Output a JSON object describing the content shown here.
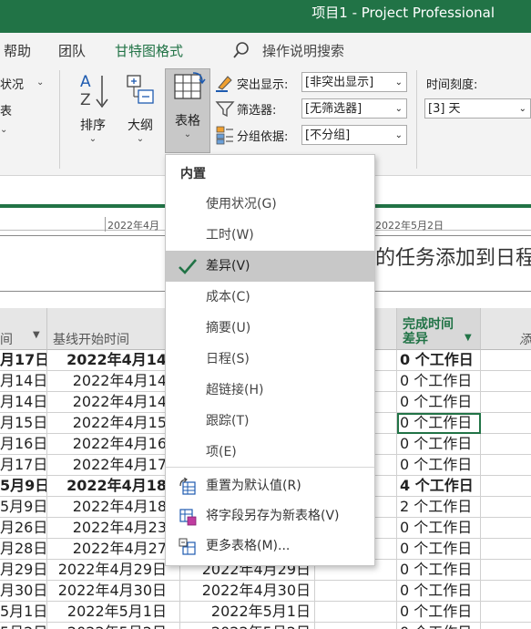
{
  "window": {
    "title": "项目1  -  Project Professional"
  },
  "tabs": [
    {
      "label": "帮助"
    },
    {
      "label": "团队"
    },
    {
      "label": "甘特图格式",
      "active": true
    },
    {
      "label": "操作说明搜索"
    }
  ],
  "ribbon": {
    "left_cut_1": "状况",
    "left_cut_2": "表",
    "sort": {
      "label": "排序"
    },
    "outline": {
      "label": "大纲"
    },
    "tables": {
      "label": "表格"
    },
    "highlight": {
      "label": "突出显示:",
      "value": "[非突出显示]"
    },
    "filter": {
      "label": "筛选器:",
      "value": "[无筛选器]"
    },
    "group": {
      "label": "分组依据:",
      "value": "[不分组]"
    },
    "timescale": {
      "label": "时间刻度:",
      "value": "[3] 天"
    }
  },
  "timeline": {
    "date_left": "2022年4月",
    "date_right": "2022年5月2日",
    "message": "的任务添加到日程表"
  },
  "grid": {
    "headers": {
      "col1": "间",
      "col2": "基线开始时间",
      "col4a": "完成时间",
      "col4b": "差异",
      "col5": "添"
    },
    "rows": [
      {
        "c1": "月17日",
        "c2": "2022年4月14",
        "c3": "年",
        "c4": "0 个工作日",
        "bold": true
      },
      {
        "c1": "月14日",
        "c2": "2022年4月14",
        "c3": "年",
        "c4": "0 个工作日"
      },
      {
        "c1": "月14日",
        "c2": "2022年4月14",
        "c3": "年",
        "c4": "0 个工作日"
      },
      {
        "c1": "月15日",
        "c2": "2022年4月15",
        "c3": "年",
        "c4": "0 个工作日",
        "focus": true
      },
      {
        "c1": "月16日",
        "c2": "2022年4月16",
        "c3": "年",
        "c4": "0 个工作日"
      },
      {
        "c1": "月17日",
        "c2": "2022年4月17",
        "c3": "年",
        "c4": "0 个工作日"
      },
      {
        "c1": "5月9日",
        "c2": "2022年4月18",
        "c3": "年",
        "c4": "4 个工作日",
        "bold": true
      },
      {
        "c1": "5月9日",
        "c2": "2022年4月18",
        "c3": "年",
        "c4": "2 个工作日"
      },
      {
        "c1": "月26日",
        "c2": "2022年4月23",
        "c3": "年",
        "c4": "0 个工作日"
      },
      {
        "c1": "月28日",
        "c2": "2022年4月27",
        "c3": "年",
        "c4": "0 个工作日"
      },
      {
        "c1": "月29日",
        "c2": "2022年4月29日",
        "c3": "2022年4月29日",
        "c4": "0 个工作日"
      },
      {
        "c1": "月30日",
        "c2": "2022年4月30日",
        "c3": "2022年4月30日",
        "c4": "0 个工作日"
      },
      {
        "c1": "5月1日",
        "c2": "2022年5月1日",
        "c3": "2022年5月1日",
        "c4": "0 个工作日"
      },
      {
        "c1": "5月2日",
        "c2": "2022年5月2日",
        "c3": "2022年5月2日",
        "c4": "0 个工作日"
      }
    ]
  },
  "menu": {
    "heading": "内置",
    "items": [
      {
        "label": "使用状况(G)"
      },
      {
        "label": "工时(W)"
      },
      {
        "label": "差异(V)",
        "selected": true
      },
      {
        "label": "成本(C)"
      },
      {
        "label": "摘要(U)"
      },
      {
        "label": "日程(S)"
      },
      {
        "label": "超链接(H)"
      },
      {
        "label": "跟踪(T)"
      },
      {
        "label": "项(E)"
      }
    ],
    "actions": [
      {
        "label": "重置为默认值(R)",
        "icon": "reset-table-icon"
      },
      {
        "label": "将字段另存为新表格(V)",
        "icon": "save-table-icon"
      },
      {
        "label": "更多表格(M)...",
        "icon": "more-tables-icon"
      }
    ]
  },
  "colors": {
    "accent": "#217346",
    "menu_selected": "#c8c8c8",
    "check": "#217346"
  }
}
